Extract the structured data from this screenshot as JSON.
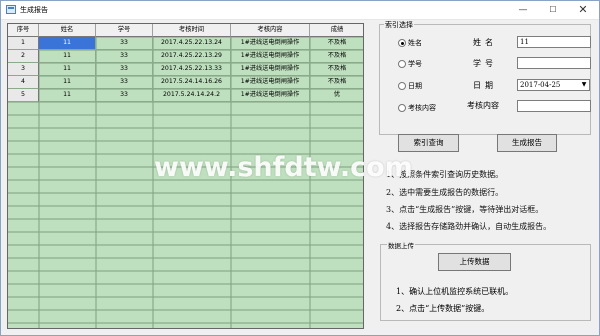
{
  "window": {
    "title": "生成报告",
    "minimize": "—",
    "maximize": "☐",
    "close": "✕"
  },
  "table": {
    "headers": [
      "序号",
      "姓名",
      "学号",
      "考核时间",
      "考核内容",
      "成绩"
    ],
    "rows": [
      {
        "no": "1",
        "name": "11",
        "id": "33",
        "time": "2017.4.25.22.13.24",
        "content": "1#进线送电倒闸操作",
        "score": "不及格"
      },
      {
        "no": "2",
        "name": "11",
        "id": "33",
        "time": "2017.4.25.22.13.29",
        "content": "1#进线送电倒闸操作",
        "score": "不及格"
      },
      {
        "no": "3",
        "name": "11",
        "id": "33",
        "time": "2017.4.25.22.13.33",
        "content": "1#进线送电倒闸操作",
        "score": "不及格"
      },
      {
        "no": "4",
        "name": "11",
        "id": "33",
        "time": "2017.5.24.14.16.26",
        "content": "1#进线送电倒闸操作",
        "score": "不及格"
      },
      {
        "no": "5",
        "name": "11",
        "id": "33",
        "time": "2017.5.24.14.24.2",
        "content": "1#进线送电倒闸操作",
        "score": "优"
      }
    ]
  },
  "search": {
    "group_title": "索引选择",
    "options": [
      "姓名",
      "学号",
      "日期",
      "考核内容"
    ],
    "selected": "姓名",
    "labels": {
      "name": "姓名",
      "id": "学号",
      "date": "日期",
      "content": "考核内容"
    },
    "values": {
      "name": "11",
      "id": "",
      "date": "2017-04-25",
      "content": ""
    }
  },
  "buttons": {
    "query": "索引查询",
    "report": "生成报告",
    "upload": "上传数据"
  },
  "instructions": [
    "1、按照条件索引查询历史数据。",
    "2、选中需要生成报告的数据行。",
    "3、点击“生成报告”按键，等待弹出对话框。",
    "4、选择报告存储路劲并确认，自动生成报告。"
  ],
  "upload": {
    "group_title": "数据上传",
    "notes": [
      "1、确认上位机监控系统已联机。",
      "2、点击“上传数据”按键。"
    ]
  },
  "watermark": "www.shfdtw.com",
  "icons": {
    "window": "report-window-icon",
    "dropdown": "chevron-down-icon"
  },
  "colors": {
    "grid": "#bfe0bf",
    "selected": "#3a74d8"
  }
}
